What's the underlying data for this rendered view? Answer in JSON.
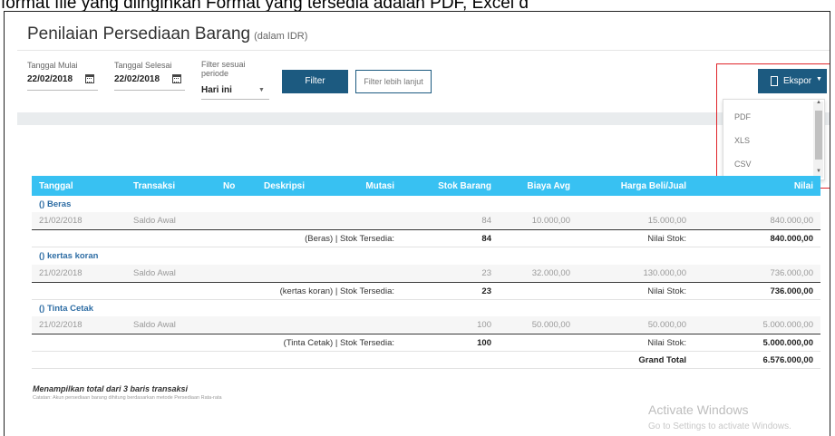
{
  "doc_line": "format file yang diinginkan Format yang tersedia adalah PDF, Excel d",
  "page": {
    "title": "Penilaian Persediaan Barang",
    "title_sub": "(dalam IDR)"
  },
  "filters": {
    "start_label": "Tanggal Mulai",
    "start_value": "22/02/2018",
    "end_label": "Tanggal Selesai",
    "end_value": "22/02/2018",
    "period_label_1": "Filter sesuai",
    "period_label_2": "periode",
    "period_value": "Hari ini",
    "filter_button": "Filter",
    "advanced_button": "Filter lebih lanjut"
  },
  "export": {
    "button_label": "Ekspor",
    "options": [
      "PDF",
      "XLS",
      "CSV"
    ]
  },
  "table": {
    "headers": [
      "Tanggal",
      "Transaksi",
      "No",
      "Deskripsi",
      "Mutasi",
      "Stok Barang",
      "Biaya Avg",
      "Harga Beli/Jual",
      "Nilai"
    ],
    "groups": [
      {
        "name": "() Beras",
        "row": {
          "date": "21/02/2018",
          "trans": "Saldo Awal",
          "stock": "84",
          "avg": "10.000,00",
          "price": "15.000,00",
          "value": "840.000,00"
        },
        "summary": {
          "label": "(Beras) | Stok Tersedia:",
          "stock": "84",
          "nilai_label": "Nilai Stok:",
          "nilai": "840.000,00"
        }
      },
      {
        "name": "() kertas koran",
        "row": {
          "date": "21/02/2018",
          "trans": "Saldo Awal",
          "stock": "23",
          "avg": "32.000,00",
          "price": "130.000,00",
          "value": "736.000,00"
        },
        "summary": {
          "label": "(kertas koran) | Stok Tersedia:",
          "stock": "23",
          "nilai_label": "Nilai Stok:",
          "nilai": "736.000,00"
        }
      },
      {
        "name": "() Tinta Cetak",
        "row": {
          "date": "21/02/2018",
          "trans": "Saldo Awal",
          "stock": "100",
          "avg": "50.000,00",
          "price": "50.000,00",
          "value": "5.000.000,00"
        },
        "summary": {
          "label": "(Tinta Cetak) | Stok Tersedia:",
          "stock": "100",
          "nilai_label": "Nilai Stok:",
          "nilai": "5.000.000,00"
        }
      }
    ],
    "grand_total_label": "Grand Total",
    "grand_total_value": "6.576.000,00"
  },
  "footer": {
    "summary": "Menampilkan total dari 3 baris transaksi",
    "note": "Catatan: Akun persediaan barang dihitung berdasarkan metode Persediaan Rata-rata"
  },
  "watermark": {
    "line1": "Activate Windows",
    "line2": "Go to Settings to activate Windows."
  },
  "colors": {
    "header_bg": "#38c1f2",
    "primary_button": "#1c5a80",
    "highlight_box": "#e0242a",
    "group_text": "#2e6da4"
  }
}
